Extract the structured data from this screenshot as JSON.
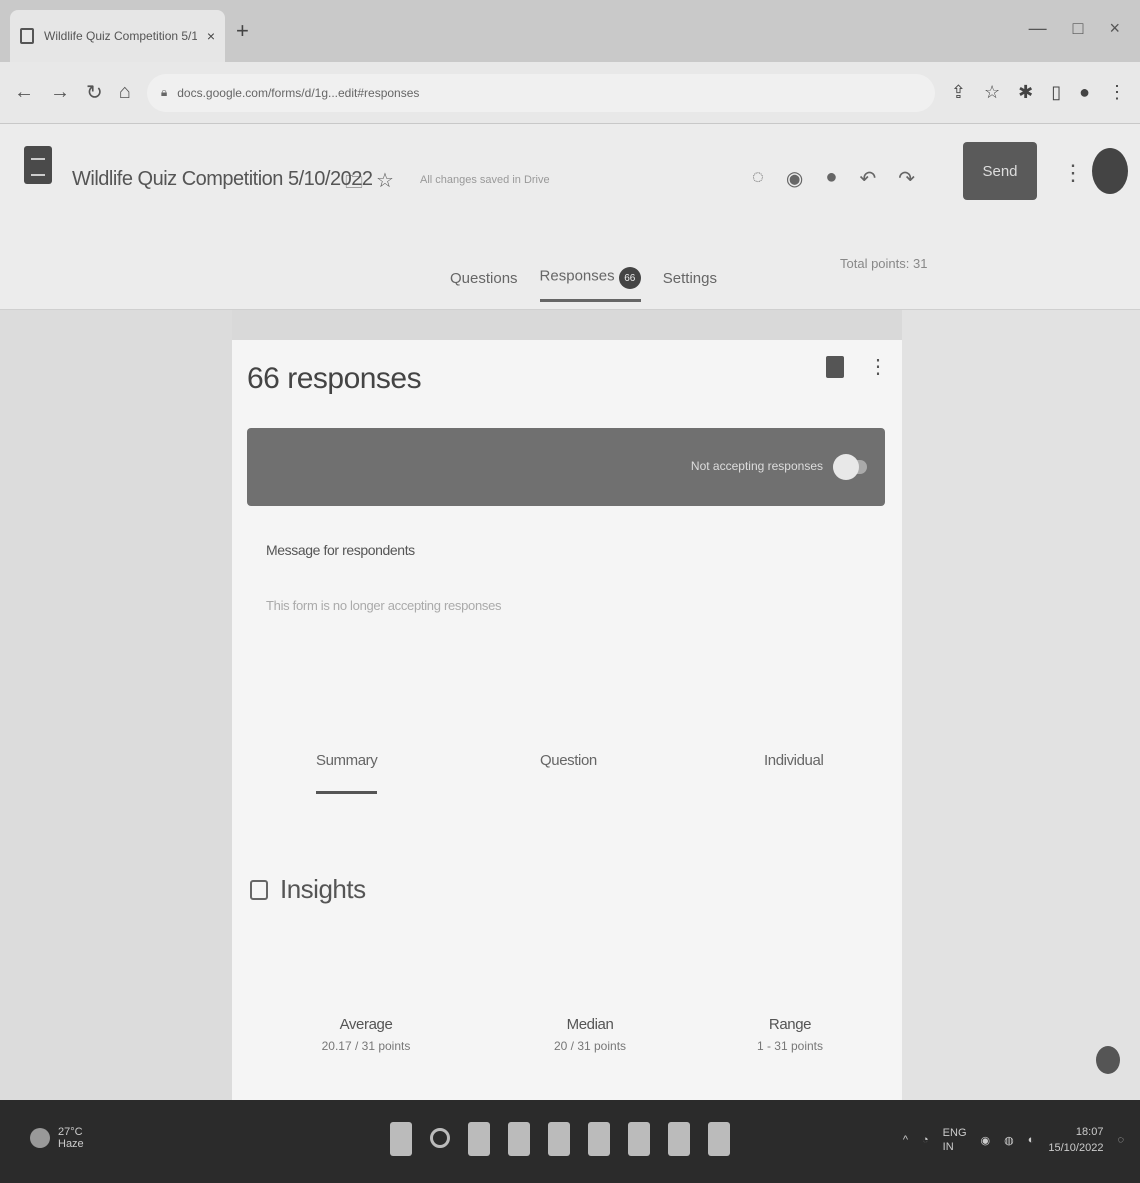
{
  "browser": {
    "tab_title": "Wildlife Quiz Competition 5/10...",
    "tab_close": "×",
    "new_tab": "+",
    "url": "docs.google.com/forms/d/1g...edit#responses",
    "window_controls": [
      "—",
      "□",
      "×"
    ]
  },
  "form": {
    "title": "Wildlife Quiz Competition 5/10/2022",
    "saved_status": "All changes saved in Drive",
    "send_label": "Send",
    "tabs": {
      "questions": "Questions",
      "responses": "Responses",
      "responses_count": "66",
      "settings": "Settings"
    },
    "total_points": "Total points: 31"
  },
  "responses": {
    "title": "66 responses",
    "accepting_label": "Not accepting responses",
    "message_label": "Message for respondents",
    "message_text": "This form is no longer accepting responses",
    "view_tabs": {
      "summary": "Summary",
      "question": "Question",
      "individual": "Individual"
    },
    "insights_title": "Insights",
    "stats": {
      "average_label": "Average",
      "average_value": "20.17 / 31 points",
      "median_label": "Median",
      "median_value": "20 / 31 points",
      "range_label": "Range",
      "range_value": "1 - 31 points"
    }
  },
  "taskbar": {
    "weather_temp": "27°C",
    "weather_desc": "Haze",
    "language": "ENG",
    "language_sub": "IN",
    "time": "18:07",
    "date": "15/10/2022"
  }
}
